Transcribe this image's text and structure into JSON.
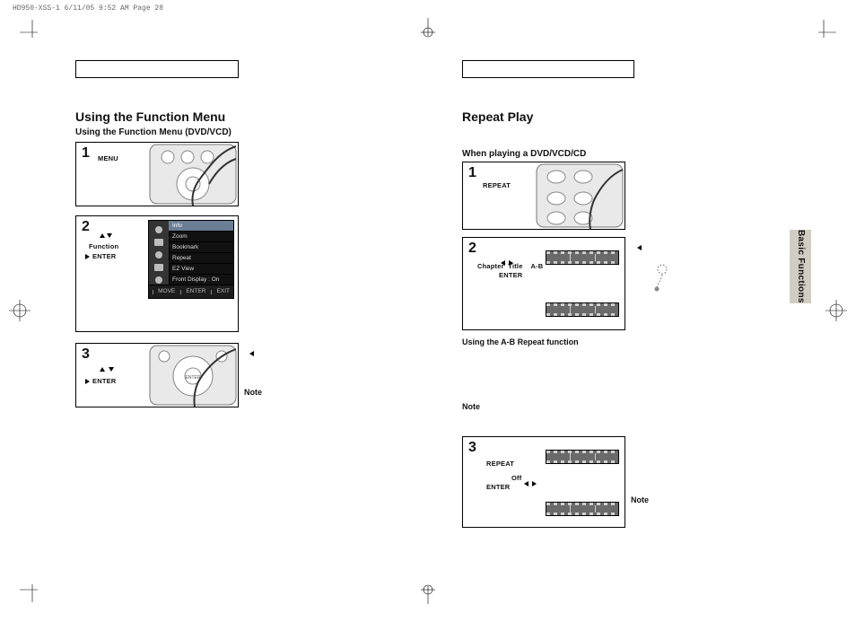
{
  "slug": "HD950-XSS-1  6/11/05  9:52 AM  Page 28",
  "left": {
    "title": "Using the Function Menu",
    "subtitle": "Using the Function Menu (DVD/VCD)",
    "steps": {
      "s1": {
        "num": "1",
        "btn": "MENU"
      },
      "s2": {
        "num": "2",
        "hint_arrows": "▲ ▼",
        "hint1": "Function",
        "hint2": "ENTER",
        "osd_rows": [
          "Info",
          "Zoom",
          "Bookmark",
          "Repeat",
          "EZ View",
          "Front Display : On"
        ]
      },
      "s3": {
        "num": "3",
        "hint_arrows": "▲ ▼",
        "hint2": "ENTER",
        "note": "Note"
      }
    }
  },
  "right": {
    "title": "Repeat Play",
    "subtitle": "When playing a DVD/VCD/CD",
    "steps": {
      "s1": {
        "num": "1",
        "btn": "REPEAT"
      },
      "s2": {
        "num": "2",
        "hint_lr": "◀ ▶",
        "line1": "Chapter  Title    A-B",
        "hint2": "ENTER"
      },
      "ab_heading": "Using the A-B Repeat function",
      "note1": "Note",
      "s3": {
        "num": "3",
        "btn": "REPEAT",
        "off": "Off",
        "hint_lr": "◀ ▶",
        "hint2": "ENTER",
        "note": "Note"
      }
    },
    "sidetab": "Basic Functions"
  },
  "osd_foot": {
    "a": "MOVE",
    "b": "ENTER",
    "c": "EXIT"
  }
}
